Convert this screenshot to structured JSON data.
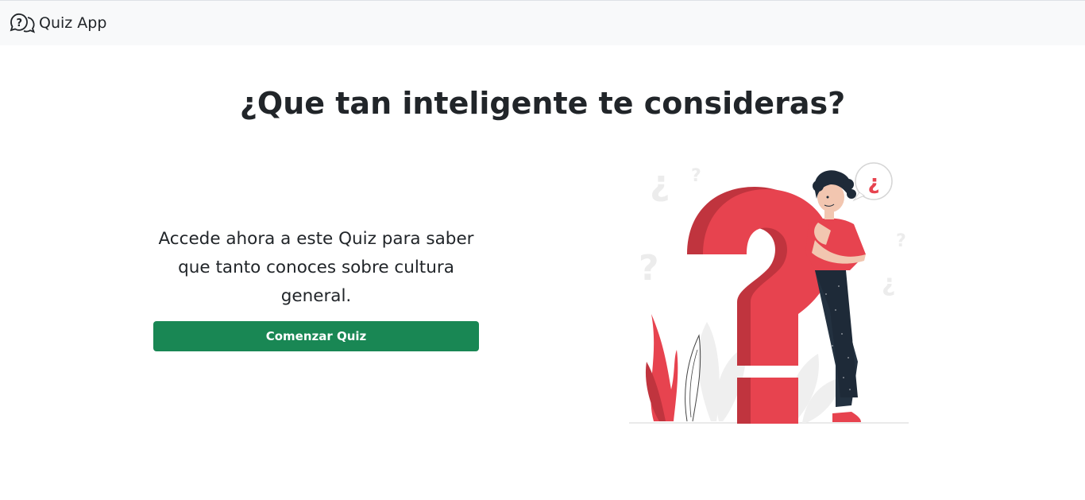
{
  "navbar": {
    "brand_icon": "question-bubbles-icon",
    "brand_label": "Quiz App"
  },
  "hero": {
    "title": "¿Que tan inteligente te consideras?",
    "description": "Accede ahora a este Quiz para saber que tanto conoces sobre cultura general.",
    "start_button_label": "Comenzar Quiz",
    "illustration": "thinking-person-question-mark-illustration",
    "speech_bubble_text": "¿"
  },
  "colors": {
    "navbar_bg": "#f8f9fa",
    "button_bg": "#198754",
    "accent_red": "#e7434f",
    "dark_red": "#c0343e",
    "text": "#212529"
  }
}
